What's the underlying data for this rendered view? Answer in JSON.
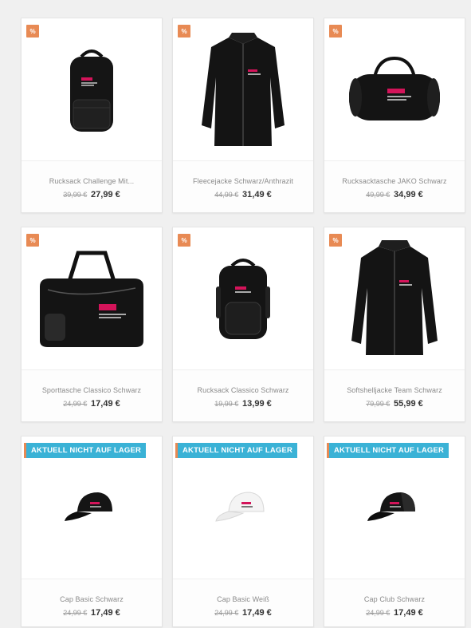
{
  "badges": {
    "percent": "%",
    "out_of_stock": "AKTUELL NICHT AUF LAGER"
  },
  "products": [
    {
      "name": "Rucksack Challenge Mit...",
      "old_price": "39,99 €",
      "new_price": "27,99 €",
      "image": "backpack-icon"
    },
    {
      "name": "Fleecejacke Schwarz/Anthrazit",
      "old_price": "44,99 €",
      "new_price": "31,49 €",
      "image": "jacket-icon"
    },
    {
      "name": "Rucksacktasche JAKO Schwarz",
      "old_price": "49,99 €",
      "new_price": "34,99 €",
      "image": "duffel-bag-icon"
    },
    {
      "name": "Sporttasche Classico Schwarz",
      "old_price": "24,99 €",
      "new_price": "17,49 €",
      "image": "sports-bag-icon"
    },
    {
      "name": "Rucksack Classico Schwarz",
      "old_price": "19,99 €",
      "new_price": "13,99 €",
      "image": "backpack-icon"
    },
    {
      "name": "Softshelljacke Team Schwarz",
      "old_price": "79,99 €",
      "new_price": "55,99 €",
      "image": "jacket-icon"
    },
    {
      "name": "Cap Basic Schwarz",
      "old_price": "24,99 €",
      "new_price": "17,49 €",
      "image": "cap-icon"
    },
    {
      "name": "Cap Basic Weiß",
      "old_price": "24,99 €",
      "new_price": "17,49 €",
      "image": "cap-icon"
    },
    {
      "name": "Cap Club Schwarz",
      "old_price": "24,99 €",
      "new_price": "17,49 €",
      "image": "cap-icon"
    }
  ],
  "colors": {
    "discount_badge": "#e88a54",
    "stock_badge": "#3ab2d6",
    "brand_logo": "#d4145a"
  }
}
